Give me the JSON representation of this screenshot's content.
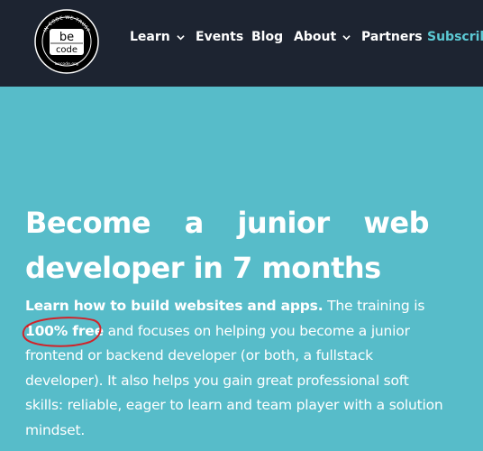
{
  "logo": {
    "ring_text": "IN CODE WE TRUST",
    "name_top": "be",
    "name_bottom": "code",
    "url": "becode.org"
  },
  "nav": {
    "items": [
      {
        "label": "Learn",
        "has_dropdown": true
      },
      {
        "label": "Events",
        "has_dropdown": false
      },
      {
        "label": "Blog",
        "has_dropdown": false
      },
      {
        "label": "About",
        "has_dropdown": true
      },
      {
        "label": "Partners",
        "has_dropdown": false
      },
      {
        "label": "Subscribe",
        "has_dropdown": false
      }
    ]
  },
  "hero": {
    "title": "Become a junior web developer in 7 months"
  },
  "intro": {
    "lead": "Learn how to build websites and apps.",
    "text1": " The training is ",
    "highlight": "100% free",
    "text2": " and focuses on helping you become a junior frontend or backend developer (or both, a fullstack developer). It also helps you gain great professional soft skills: reliable, eager to learn and team player with a solution mindset."
  },
  "colors": {
    "header_bg": "#1d2431",
    "page_bg": "#57bcc9",
    "subscribe": "#5cc9d4",
    "annotation": "#d0232a"
  }
}
